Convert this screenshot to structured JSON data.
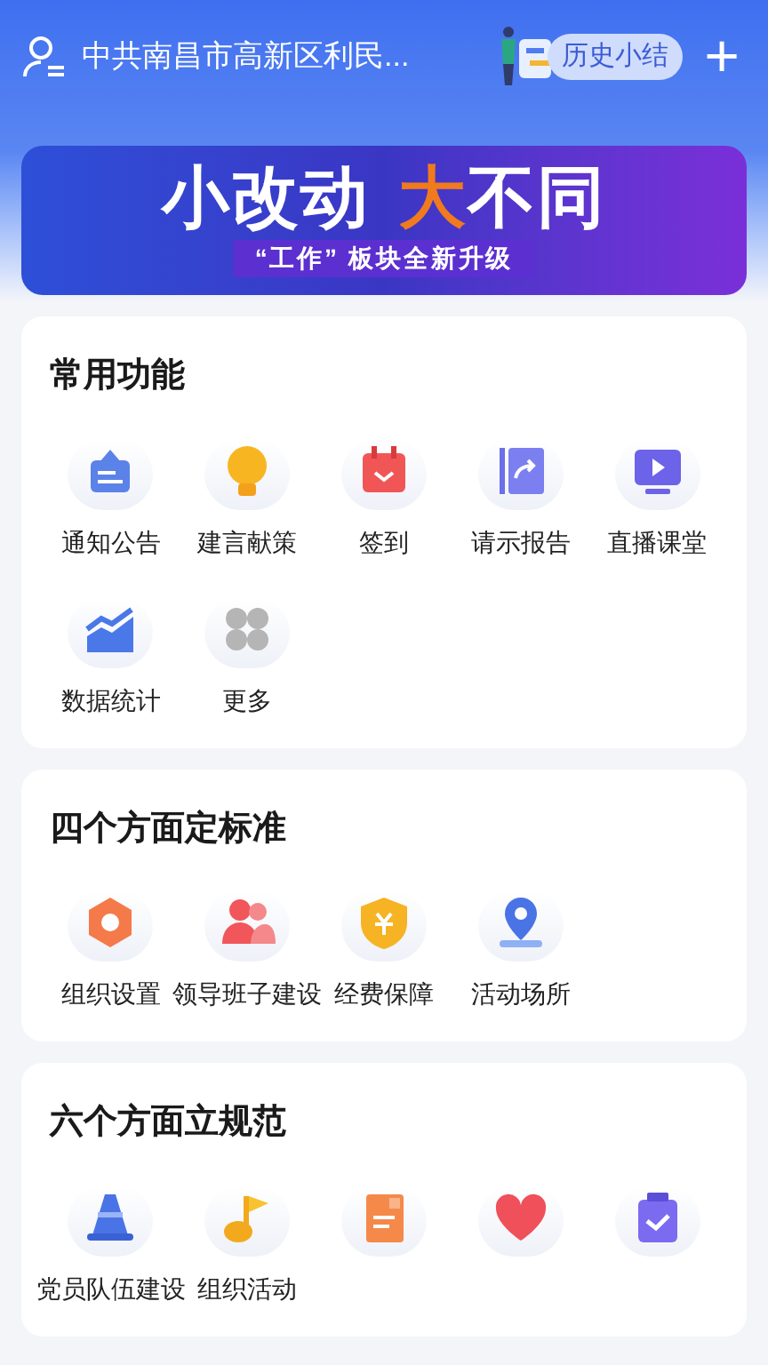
{
  "top_bar": {
    "org_name": "中共南昌市高新区利民...",
    "history_button": "历史小结",
    "add_button": "+"
  },
  "banner": {
    "title": [
      {
        "text": "小改动",
        "kind": "plain"
      },
      {
        "text": "大",
        "kind": "accent"
      },
      {
        "text": "不同",
        "kind": "plain"
      }
    ],
    "subtitle": "“工作” 板块全新升级"
  },
  "sections": [
    {
      "title": "常用功能",
      "items": [
        {
          "label": "通知公告",
          "kind": "notice"
        },
        {
          "label": "建言献策",
          "kind": "bulb"
        },
        {
          "label": "签到",
          "kind": "calendar"
        },
        {
          "label": "请示报告",
          "kind": "report"
        },
        {
          "label": "直播课堂",
          "kind": "live"
        },
        {
          "label": "数据统计",
          "kind": "chart"
        },
        {
          "label": "更多",
          "kind": "more"
        }
      ]
    },
    {
      "title": "四个方面定标准",
      "items": [
        {
          "label": "组织设置",
          "kind": "hexagon"
        },
        {
          "label": "领导班子建设",
          "kind": "people"
        },
        {
          "label": "经费保障",
          "kind": "shield"
        },
        {
          "label": "活动场所",
          "kind": "pin"
        }
      ]
    },
    {
      "title": "六个方面立规范",
      "items": [
        {
          "label": "党员队伍建设",
          "kind": "cone"
        },
        {
          "label": "组织活动",
          "kind": "flag"
        },
        {
          "kind": "doc"
        },
        {
          "kind": "heart"
        },
        {
          "kind": "task"
        }
      ]
    }
  ]
}
